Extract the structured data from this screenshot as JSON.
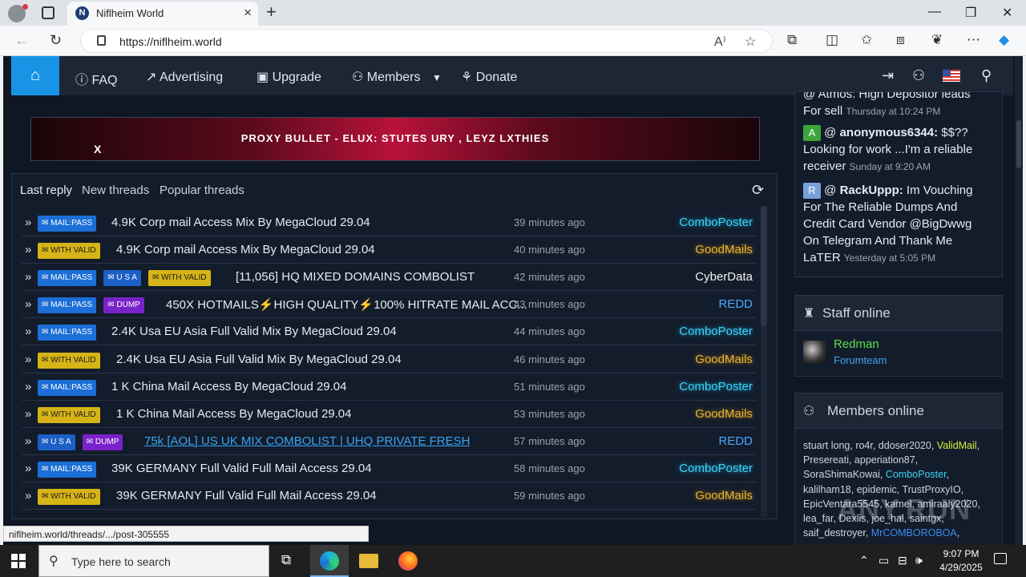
{
  "browser": {
    "tab_title": "Niflheim World",
    "tab_favicon": "N",
    "url": "https://niflheim.world",
    "status_url": "niflheim.world/threads/.../post-305555"
  },
  "nav": {
    "faq": "FAQ",
    "advertising": "Advertising",
    "upgrade": "Upgrade",
    "members": "Members",
    "donate": "Donate"
  },
  "banner": {
    "text": "PROXY BULLET - ELUX: STUTES URY , LEYZ LXTHIES",
    "close": "X"
  },
  "threads_tabs": {
    "last_reply": "Last reply",
    "new_threads": "New threads",
    "popular": "Popular threads"
  },
  "tags": {
    "mail": "MAIL:PASS",
    "valid": "WITH VALID",
    "usa": "U S A",
    "dump": "DUMP"
  },
  "threads": [
    {
      "tags": [
        "mail"
      ],
      "title": "4.9K Corp mail Access Mix By MegaCloud 29.04",
      "time": "39 minutes ago",
      "user": "ComboPoster",
      "ucls": "u-combo",
      "link": false
    },
    {
      "tags": [
        "valid"
      ],
      "title": "4.9K Corp mail Access Mix By MegaCloud 29.04",
      "time": "40 minutes ago",
      "user": "GoodMails",
      "ucls": "u-good",
      "link": false
    },
    {
      "tags": [
        "mail",
        "usa",
        "valid"
      ],
      "title": "[11,056] HQ MIXED DOMAINS COMBOLIST",
      "time": "42 minutes ago",
      "user": "CyberData",
      "ucls": "u-cyber",
      "link": false
    },
    {
      "tags": [
        "mail",
        "dump"
      ],
      "title": "450X HOTMAILS⚡HIGH QUALITY⚡100% HITRATE MAIL ACC...",
      "time": "43 minutes ago",
      "user": "REDD",
      "ucls": "u-redd",
      "link": false
    },
    {
      "tags": [
        "mail"
      ],
      "title": "2.4K Usa EU Asia Full Valid Mix By MegaCloud 29.04",
      "time": "44 minutes ago",
      "user": "ComboPoster",
      "ucls": "u-combo",
      "link": false
    },
    {
      "tags": [
        "valid"
      ],
      "title": "2.4K Usa EU Asia Full Valid Mix By MegaCloud 29.04",
      "time": "46 minutes ago",
      "user": "GoodMails",
      "ucls": "u-good",
      "link": false
    },
    {
      "tags": [
        "mail"
      ],
      "title": "1 K China Mail Access By MegaCloud 29.04",
      "time": "51 minutes ago",
      "user": "ComboPoster",
      "ucls": "u-combo",
      "link": false
    },
    {
      "tags": [
        "valid"
      ],
      "title": "1 K China Mail Access By MegaCloud 29.04",
      "time": "53 minutes ago",
      "user": "GoodMails",
      "ucls": "u-good",
      "link": false
    },
    {
      "tags": [
        "usa",
        "dump"
      ],
      "title": "75k [AOL] US UK MIX COMBOLIST | UHQ PRIVATE FRESH",
      "time": "57 minutes ago",
      "user": "REDD",
      "ucls": "u-redd",
      "link": true
    },
    {
      "tags": [
        "mail"
      ],
      "title": "39K GERMANY Full Valid Full Mail Access 29.04",
      "time": "58 minutes ago",
      "user": "ComboPoster",
      "ucls": "u-combo",
      "link": false
    },
    {
      "tags": [
        "valid"
      ],
      "title": "39K GERMANY Full Valid Full Mail Access 29.04",
      "time": "59 minutes ago",
      "user": "GoodMails",
      "ucls": "u-good",
      "link": false
    }
  ],
  "chat": {
    "msg1_text": "@ Atmos: High Depositor leads For sell",
    "msg1_time": "Thursday at 10:24 PM",
    "msg2_avatar": "A",
    "msg2_name": "anonymous6344:",
    "msg2_text": "$$?? Looking for work ...I'm a reliable receiver",
    "msg2_time": "Sunday at 9:20 AM",
    "msg3_avatar": "R",
    "msg3_name": "RackUppp:",
    "msg3_text": "Im Vouching For The Reliable Dumps And Credit Card Vendor @BigDwwg On Telegram And Thank Me LaTER",
    "msg3_time": "Yesterday at 5:05 PM"
  },
  "staff": {
    "title": "Staff online",
    "name": "Redman",
    "role": "Forumteam"
  },
  "members_online": {
    "title": "Members online",
    "part1": "stuart long, ro4r, ddoser2020, ",
    "valid": "ValidMail",
    "part2": ", Presereati, apperiation87, SoraShimaKowai, ",
    "combo": "ComboPoster",
    "part3": ", kalilham18, epidemic, TrustProxyIO, EpicVentara5545, kamel, amiraaly2020, lea_far, Dexlis, joe_hal, saintgx, saif_destroyer, ",
    "combob": "MrCOMBOROBOA",
    "part4": ","
  },
  "watermark": "ANY.RUN",
  "taskbar": {
    "search_placeholder": "Type here to search",
    "time": "9:07 PM",
    "date": "4/29/2025"
  }
}
